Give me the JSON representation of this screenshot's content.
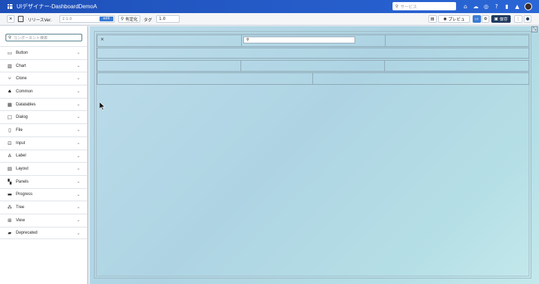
{
  "app": {
    "title": "UIデザイナー-DashboardDemoA"
  },
  "global_search": {
    "placeholder": "サービス"
  },
  "toolbar": {
    "release_label": "リリースVer.",
    "version_value": "2.1.0",
    "edit_label": "edit",
    "fix_label": "有定化",
    "tag_label": "タグ",
    "tag_value": "1.0",
    "preview_label": "プレビュ",
    "save_label": "保存"
  },
  "sidebar": {
    "search_placeholder": "コンポーネント検索",
    "items": [
      {
        "label": "Button",
        "icon": "button-icon"
      },
      {
        "label": "Chart",
        "icon": "chart-icon"
      },
      {
        "label": "Clone",
        "icon": "clone-icon"
      },
      {
        "label": "Common",
        "icon": "bell-icon"
      },
      {
        "label": "Datatables",
        "icon": "table-icon"
      },
      {
        "label": "Dialog",
        "icon": "dialog-icon"
      },
      {
        "label": "File",
        "icon": "file-icon"
      },
      {
        "label": "Input",
        "icon": "input-icon"
      },
      {
        "label": "Label",
        "icon": "label-icon"
      },
      {
        "label": "Layout",
        "icon": "layout-icon"
      },
      {
        "label": "Panels",
        "icon": "panels-icon"
      },
      {
        "label": "Progress",
        "icon": "progress-icon"
      },
      {
        "label": "Tree",
        "icon": "tree-icon"
      },
      {
        "label": "View",
        "icon": "view-icon"
      },
      {
        "label": "Deprecated",
        "icon": "deprecated-icon"
      }
    ]
  },
  "colors": {
    "topbar": "#1e4fb8",
    "accent": "#3a7bd5",
    "canvas": "#b5dbe8"
  }
}
